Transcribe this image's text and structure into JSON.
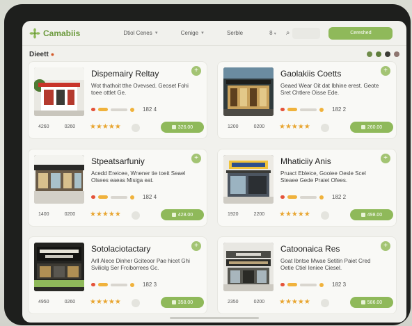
{
  "app": {
    "brand": "Camabiis"
  },
  "nav": {
    "items": [
      "Dtiol Cenes",
      "Cenige"
    ],
    "plain": "Serble",
    "person_label": "•"
  },
  "top_cta": "Cereshed",
  "page": {
    "title": "Dieett"
  },
  "colors": {
    "accent": "#8fb95a",
    "brand": "#6c9a3e",
    "star": "#e8a530"
  },
  "cards": [
    {
      "title": "Dispemairy Reltay",
      "desc": "Wot thathoit tthe Ovevsed. Geoset Fohi toee ottlet Ge.",
      "count": "182 4",
      "stats": [
        "4260",
        "0260"
      ],
      "stars": "★★★★★",
      "price": "326.00",
      "thumb": "storefront-red"
    },
    {
      "title": "Gaolakiis Coetts",
      "desc": "Geaed Wear Oit dat Ibhine erest. Geote Sret Chtlere Oisse Ede.",
      "count": "182 2",
      "stats": [
        "1200",
        "0200"
      ],
      "stars": "★★★★★",
      "price": "260.00",
      "thumb": "storefront-night"
    },
    {
      "title": "Stpeatsarfuniy",
      "desc": "Acedd Ereicee, Wnener tie toeit Seael Olsees eaeas Misiga eat.",
      "count": "182 4",
      "stats": [
        "1400",
        "0200"
      ],
      "stars": "★★★★★",
      "price": "428.00",
      "thumb": "storefront-street"
    },
    {
      "title": "Mhaticiiy Anis",
      "desc": "Pruact Ebleice, Gooiee Oesle Scel Steaee Gede Praiet Ofees.",
      "count": "182 2",
      "stats": [
        "1920",
        "2200"
      ],
      "stars": "★★★★★",
      "price": "498.00",
      "thumb": "storefront-sign"
    },
    {
      "title": "Sotolaciotactary",
      "desc": "Arll Alece Dinher Gciteoor Pae hicet Ghi Sviliolg Ser Frciborrees Gc.",
      "count": "182 3",
      "stats": [
        "4950",
        "0260"
      ],
      "stars": "★★★★★",
      "price": "358.00",
      "thumb": "storefront-dark"
    },
    {
      "title": "Catoonaica Res",
      "desc": "Goat Ibntse Mwae Setitin Paiet Cred Oetie Ctiel Ieniee Ciesel.",
      "count": "182 3",
      "stats": [
        "2350",
        "0200"
      ],
      "stars": "★★★★★",
      "price": "586.00",
      "thumb": "storefront-grey"
    }
  ]
}
